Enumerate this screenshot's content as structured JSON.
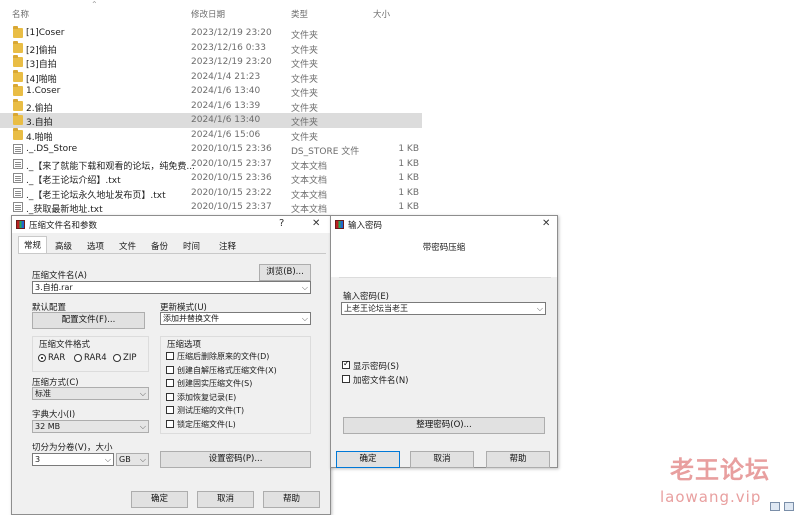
{
  "explorer": {
    "columns": {
      "name": "名称",
      "date": "修改日期",
      "type": "类型",
      "size": "大小"
    },
    "rows": [
      {
        "icon": "folder-icon",
        "name": "[1]Coser",
        "date": "2023/12/19 23:20",
        "type": "文件夹",
        "size": ""
      },
      {
        "icon": "folder-icon",
        "name": "[2]偷拍",
        "date": "2023/12/16 0:33",
        "type": "文件夹",
        "size": ""
      },
      {
        "icon": "folder-icon",
        "name": "[3]自拍",
        "date": "2023/12/19 23:20",
        "type": "文件夹",
        "size": ""
      },
      {
        "icon": "folder-icon",
        "name": "[4]啪啪",
        "date": "2024/1/4 21:23",
        "type": "文件夹",
        "size": ""
      },
      {
        "icon": "folder-icon",
        "name": "1.Coser",
        "date": "2024/1/6 13:40",
        "type": "文件夹",
        "size": ""
      },
      {
        "icon": "folder-icon",
        "name": "2.偷拍",
        "date": "2024/1/6 13:39",
        "type": "文件夹",
        "size": ""
      },
      {
        "icon": "folder-icon",
        "name": "3.自拍",
        "date": "2024/1/6 13:40",
        "type": "文件夹",
        "size": "",
        "selected": true
      },
      {
        "icon": "folder-icon",
        "name": "4.啪啪",
        "date": "2024/1/6 15:06",
        "type": "文件夹",
        "size": ""
      },
      {
        "icon": "file-icon",
        "name": "._.DS_Store",
        "date": "2020/10/15 23:36",
        "type": "DS_STORE 文件",
        "size": "1 KB"
      },
      {
        "icon": "file-icon",
        "name": "._【来了就能下载和观看的论坛，纯免费...",
        "date": "2020/10/15 23:37",
        "type": "文本文档",
        "size": "1 KB"
      },
      {
        "icon": "file-icon",
        "name": "._【老王论坛介绍】.txt",
        "date": "2020/10/15 23:36",
        "type": "文本文档",
        "size": "1 KB"
      },
      {
        "icon": "file-icon",
        "name": "._【老王论坛永久地址发布页】.txt",
        "date": "2020/10/15 23:22",
        "type": "文本文档",
        "size": "1 KB"
      },
      {
        "icon": "file-icon",
        "name": "._获取最新地址.txt",
        "date": "2020/10/15 23:37",
        "type": "文本文档",
        "size": "1 KB"
      }
    ]
  },
  "archive_dialog": {
    "title": "压缩文件名和参数",
    "help_glyph": "?",
    "close_glyph": "✕",
    "tabs": [
      "常规",
      "高级",
      "选项",
      "文件",
      "备份",
      "时间",
      "注释"
    ],
    "archive_name_label": "压缩文件名(A)",
    "archive_name_value": "3.自拍.rar",
    "browse_label": "浏览(B)...",
    "default_config_label": "默认配置",
    "profiles_label": "配置文件(F)...",
    "update_mode_label": "更新模式(U)",
    "update_mode_value": "添加并替换文件",
    "format_group_label": "压缩文件格式",
    "formats": [
      "RAR",
      "RAR4",
      "ZIP"
    ],
    "options_group_label": "压缩选项",
    "options": [
      "压缩后删除原来的文件(D)",
      "创建自解压格式压缩文件(X)",
      "创建固实压缩文件(S)",
      "添加恢复记录(E)",
      "测试压缩的文件(T)",
      "锁定压缩文件(L)"
    ],
    "method_label": "压缩方式(C)",
    "method_value": "标准",
    "dict_label": "字典大小(I)",
    "dict_value": "32 MB",
    "split_label": "切分为分卷(V)，大小",
    "split_value": "3",
    "split_unit": "GB",
    "set_password_label": "设置密码(P)...",
    "ok_label": "确定",
    "cancel_label": "取消",
    "help_label": "帮助"
  },
  "password_dialog": {
    "title": "输入密码",
    "close_glyph": "✕",
    "heading": "带密码压缩",
    "password_label": "输入密码(E)",
    "password_value": "上老王论坛当老王",
    "show_password_label": "显示密码(S)",
    "encrypt_names_label": "加密文件名(N)",
    "organize_label": "整理密码(O)...",
    "ok_label": "确定",
    "cancel_label": "取消",
    "help_label": "帮助"
  },
  "watermark": {
    "cn": "老王论坛",
    "en": "laowang.vip"
  }
}
